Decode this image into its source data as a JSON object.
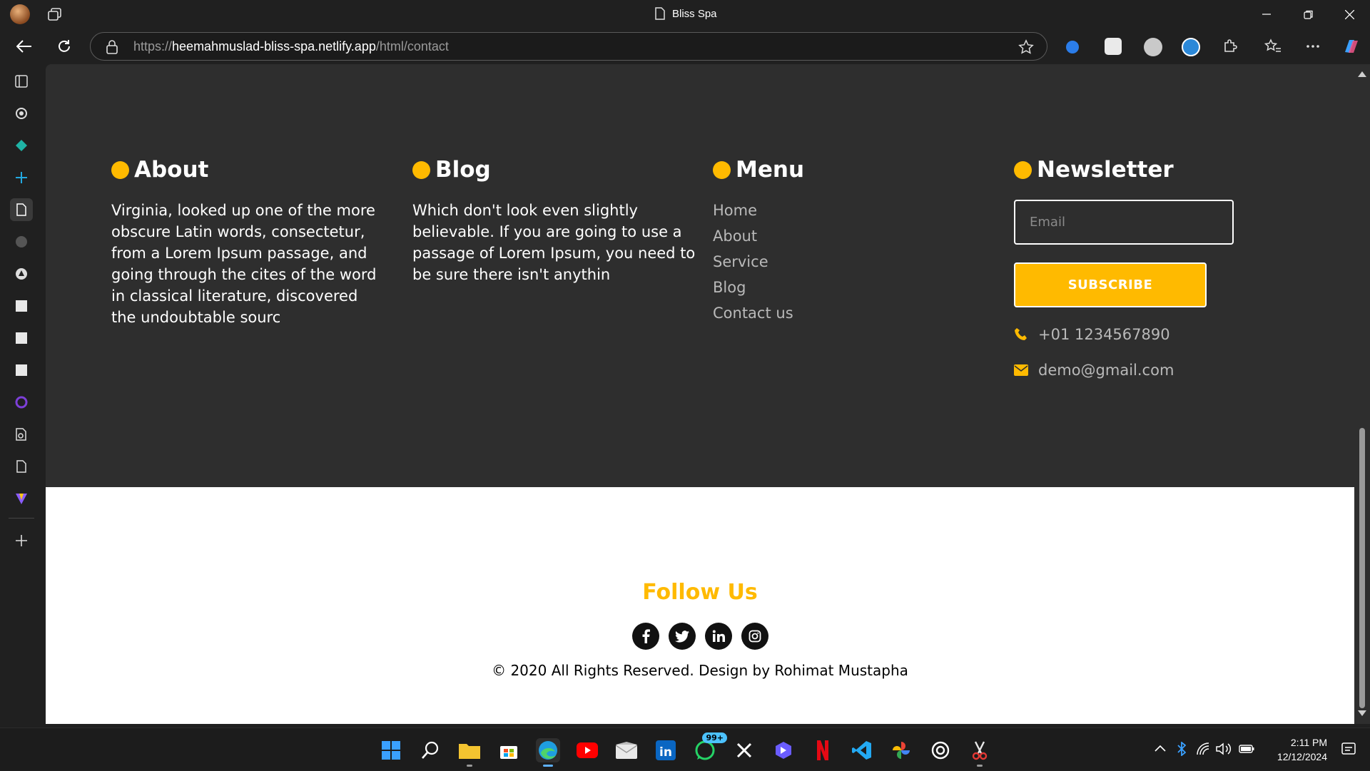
{
  "window": {
    "title": "Bliss Spa"
  },
  "address_bar": {
    "url_scheme": "https://",
    "url_host": "heemahmuslad-bliss-spa.netlify.app",
    "url_path": "/html/contact"
  },
  "footer": {
    "about": {
      "heading": "About",
      "text": "Virginia, looked up one of the more obscure Latin words, consectetur, from a Lorem Ipsum passage, and going through the cites of the word in classical literature, discovered the undoubtable sourc"
    },
    "blog": {
      "heading": "Blog",
      "text": "Which don't look even slightly believable. If you are going to use a passage of Lorem Ipsum, you need to be sure there isn't anythin"
    },
    "menu": {
      "heading": "Menu",
      "items": [
        "Home",
        "About",
        "Service",
        "Blog",
        "Contact us"
      ]
    },
    "newsletter": {
      "heading": "Newsletter",
      "email_placeholder": "Email",
      "subscribe_label": "SUBSCRIBE",
      "phone": "+01 1234567890",
      "email": "demo@gmail.com"
    },
    "follow": {
      "heading": "Follow Us",
      "socials": [
        "facebook-icon",
        "twitter-icon",
        "linkedin-icon",
        "instagram-icon"
      ]
    },
    "copyright": "© 2020 All Rights Reserved. Design by Rohimat Mustapha"
  },
  "colors": {
    "accent": "#ffba00",
    "dark_bg": "#2e2e2e",
    "light_bg": "#ffffff"
  },
  "taskbar": {
    "whatsapp_badge": "99+",
    "clock_time": "2:11 PM",
    "clock_date": "12/12/2024"
  }
}
